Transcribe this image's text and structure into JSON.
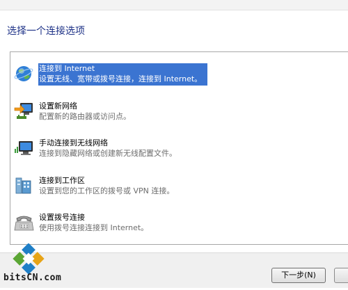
{
  "heading": "选择一个连接选项",
  "options": [
    {
      "title": "连接到 Internet",
      "desc": "设置无线、宽带或拨号连接，连接到 Internet。",
      "selected": true,
      "icon": "globe-icon"
    },
    {
      "title": "设置新网络",
      "desc": "配置新的路由器或访问点。",
      "selected": false,
      "icon": "network-setup-icon"
    },
    {
      "title": "手动连接到无线网络",
      "desc": "连接到隐藏网络或创建新无线配置文件。",
      "selected": false,
      "icon": "wireless-computer-icon"
    },
    {
      "title": "连接到工作区",
      "desc": "设置到您的工作区的拨号或 VPN 连接。",
      "selected": false,
      "icon": "workplace-building-icon"
    },
    {
      "title": "设置拨号连接",
      "desc": "使用拨号连接连接到 Internet。",
      "selected": false,
      "icon": "dialup-phone-icon"
    }
  ],
  "buttons": {
    "next": "下一步(N)"
  },
  "watermark": {
    "text": "bitsCN.com"
  },
  "colors": {
    "heading": "#1e3287",
    "selection": "#3b74d1"
  }
}
